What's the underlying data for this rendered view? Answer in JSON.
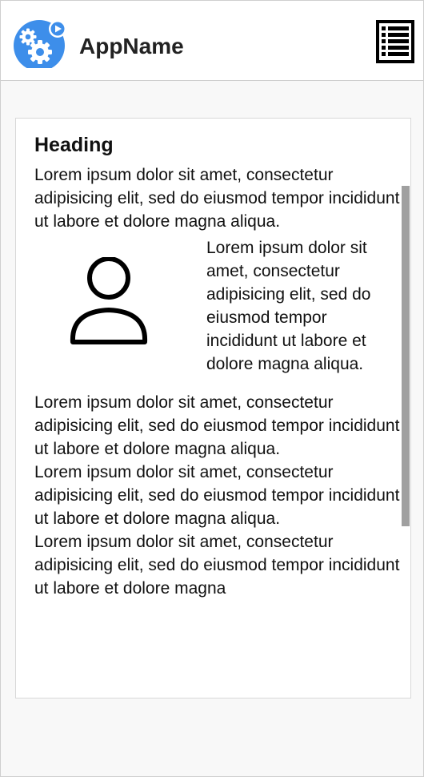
{
  "header": {
    "app_name": "AppName",
    "logo_icon": "gears-play-icon",
    "menu_icon": "menu-list-icon",
    "accent_color": "#3D8EEA"
  },
  "content": {
    "heading": "Heading",
    "intro": "Lorem ipsum dolor sit amet, consectetur adipisicing elit, sed do eiusmod tempor incididunt ut labore et dolore magna aliqua.",
    "media": {
      "icon": "user-icon",
      "text": "Lorem ipsum dolor sit amet, consectetur adipisicing elit, sed do eiusmod tempor incididunt ut labore et dolore magna aliqua."
    },
    "paragraphs": [
      "Lorem ipsum dolor sit amet, consectetur adipisicing elit, sed do eiusmod tempor incididunt ut labore et dolore magna aliqua.",
      "Lorem ipsum dolor sit amet, consectetur adipisicing elit, sed do eiusmod tempor incididunt ut labore et dolore magna aliqua.",
      "Lorem ipsum dolor sit amet, consectetur adipisicing elit, sed do eiusmod tempor incididunt ut labore et dolore magna"
    ]
  }
}
